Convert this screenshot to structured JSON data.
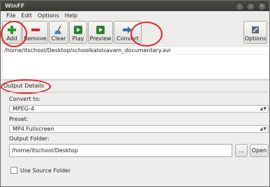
{
  "window": {
    "title": "WinFF"
  },
  "menu": [
    "File",
    "Edit",
    "Options",
    "Help"
  ],
  "toolbar": {
    "add": "Add",
    "remove": "Remove",
    "clear": "Clear",
    "play": "Play",
    "preview": "Preview",
    "convert": "Convert",
    "options": "Options"
  },
  "file_list": {
    "path": "/home/itschool/Desktop/schoolkalolsavam_documentary.avi"
  },
  "output_details": {
    "tab_label": "Output Details",
    "convert_to_label": "Convert to:",
    "convert_to_value": "MPEG-4",
    "preset_label": "Preset:",
    "preset_value": "MP4 Fullscreen",
    "output_folder_label": "Output Folder:",
    "output_folder_value": "/home/itschool/Desktop",
    "browse_label": "...",
    "open_label": "Open",
    "use_source_folder_label": "Use Source Folder",
    "use_source_folder_checked": false
  },
  "colors": {
    "highlight_circle": "#e0262b",
    "titlebar": "#3f3e39"
  }
}
